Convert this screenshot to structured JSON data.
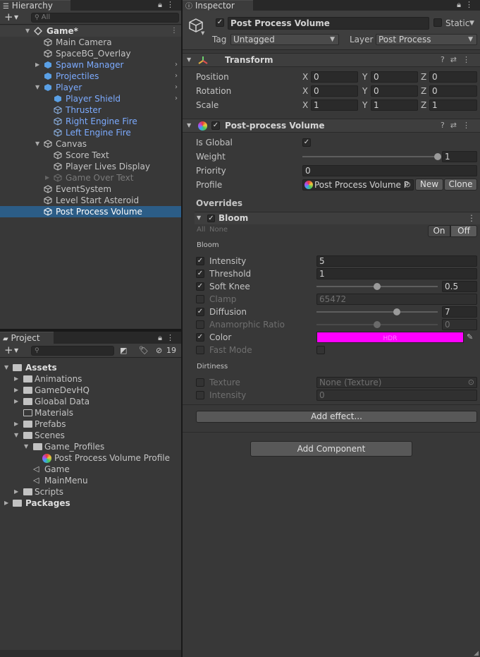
{
  "hierarchy": {
    "tab_title": "Hierarchy",
    "search_placeholder": "All",
    "rows": [
      {
        "label": "Game*"
      },
      {
        "label": "Main Camera"
      },
      {
        "label": "SpaceBG_Overlay"
      },
      {
        "label": "Spawn Manager"
      },
      {
        "label": "Projectiles"
      },
      {
        "label": "Player"
      },
      {
        "label": "Player Shield"
      },
      {
        "label": "Thruster"
      },
      {
        "label": "Right Engine Fire"
      },
      {
        "label": "Left  Engine Fire"
      },
      {
        "label": "Canvas"
      },
      {
        "label": "Score Text"
      },
      {
        "label": "Player Lives Display"
      },
      {
        "label": "Game Over Text"
      },
      {
        "label": "EventSystem"
      },
      {
        "label": "Level Start Asteroid"
      },
      {
        "label": "Post Process Volume"
      }
    ]
  },
  "project": {
    "tab_title": "Project",
    "hidden_count": "19",
    "rows": [
      {
        "label": "Assets"
      },
      {
        "label": "Animations"
      },
      {
        "label": "GameDevHQ"
      },
      {
        "label": "Gloabal Data"
      },
      {
        "label": "Materials"
      },
      {
        "label": "Prefabs"
      },
      {
        "label": "Scenes"
      },
      {
        "label": "Game_Profiles"
      },
      {
        "label": "Post Process Volume Profile"
      },
      {
        "label": "Game"
      },
      {
        "label": "MainMenu"
      },
      {
        "label": "Scripts"
      },
      {
        "label": "Packages"
      }
    ]
  },
  "inspector": {
    "tab_title": "Inspector",
    "object_name": "Post Process Volume",
    "static_label": "Static",
    "tag_label": "Tag",
    "tag_value": "Untagged",
    "layer_label": "Layer",
    "layer_value": "Post Process",
    "transform": {
      "title": "Transform",
      "position_label": "Position",
      "rotation_label": "Rotation",
      "scale_label": "Scale",
      "x": "X",
      "y": "Y",
      "z": "Z",
      "position": [
        "0",
        "0",
        "0"
      ],
      "rotation": [
        "0",
        "0",
        "0"
      ],
      "scale": [
        "1",
        "1",
        "1"
      ]
    },
    "volume": {
      "title": "Post-process Volume",
      "is_global_label": "Is Global",
      "weight_label": "Weight",
      "weight_value": "1",
      "weight_fraction": 1.0,
      "priority_label": "Priority",
      "priority_value": "0",
      "profile_label": "Profile",
      "profile_value": "Post Process Volume P",
      "new_label": "New",
      "clone_label": "Clone",
      "overrides_label": "Overrides"
    },
    "bloom": {
      "title": "Bloom",
      "all_label": "All",
      "none_label": "None",
      "on_label": "On",
      "off_label": "Off",
      "section_bloom": "Bloom",
      "intensity_label": "Intensity",
      "intensity_value": "5",
      "threshold_label": "Threshold",
      "threshold_value": "1",
      "soft_knee_label": "Soft Knee",
      "soft_knee_value": "0.5",
      "soft_knee_fraction": 0.5,
      "clamp_label": "Clamp",
      "clamp_value": "65472",
      "diffusion_label": "Diffusion",
      "diffusion_value": "7",
      "diffusion_fraction": 0.66,
      "anamorphic_label": "Anamorphic Ratio",
      "anamorphic_value": "0",
      "anamorphic_fraction": 0.5,
      "color_label": "Color",
      "color_value": "#ff00ff",
      "hdr_label": "HDR",
      "fast_mode_label": "Fast Mode",
      "section_dirtiness": "Dirtiness",
      "texture_label": "Texture",
      "texture_value": "None (Texture)",
      "dirt_intensity_label": "Intensity",
      "dirt_intensity_value": "0"
    },
    "add_effect_label": "Add effect...",
    "add_component_label": "Add Component"
  }
}
